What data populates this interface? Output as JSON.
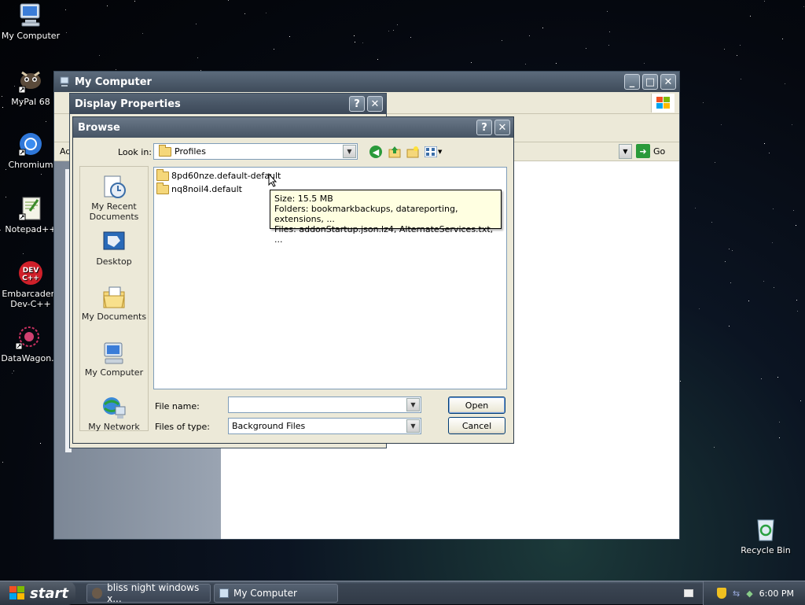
{
  "desktop": {
    "icons": [
      {
        "label": "My Computer",
        "icon": "my-computer-icon"
      },
      {
        "label": "MyPal 68",
        "icon": "mypal-icon"
      },
      {
        "label": "Chromium",
        "icon": "chromium-icon"
      },
      {
        "label": "Notepad++",
        "icon": "notepadpp-icon"
      },
      {
        "label": "Embarcadero Dev-C++",
        "icon": "devcpp-icon"
      },
      {
        "label": "DataWagon.",
        "icon": "datawagon-icon"
      },
      {
        "label": "Recycle Bin",
        "icon": "recycle-bin-icon"
      }
    ]
  },
  "my_computer_window": {
    "title": "My Computer",
    "address_label": "Ad",
    "go_label": "Go"
  },
  "display_properties": {
    "title": "Display Properties"
  },
  "browse_dialog": {
    "title": "Browse",
    "look_in_label": "Look in:",
    "look_in_value": "Profiles",
    "places": [
      "My Recent Documents",
      "Desktop",
      "My Documents",
      "My Computer",
      "My Network"
    ],
    "files": [
      "8pd60nze.default-default",
      "nq8noil4.default"
    ],
    "tooltip": {
      "size": "Size: 15.5 MB",
      "folders": "Folders: bookmarkbackups, datareporting, extensions, ...",
      "files": "Files: addonStartup.json.lz4, AlternateServices.txt, ..."
    },
    "file_name_label": "File name:",
    "file_name_value": "",
    "files_of_type_label": "Files of type:",
    "files_of_type_value": "Background Files",
    "open_label": "Open",
    "cancel_label": "Cancel"
  },
  "taskbar": {
    "start_label": "start",
    "buttons": [
      "bliss night windows x...",
      "My Computer"
    ],
    "clock": "6:00 PM"
  }
}
